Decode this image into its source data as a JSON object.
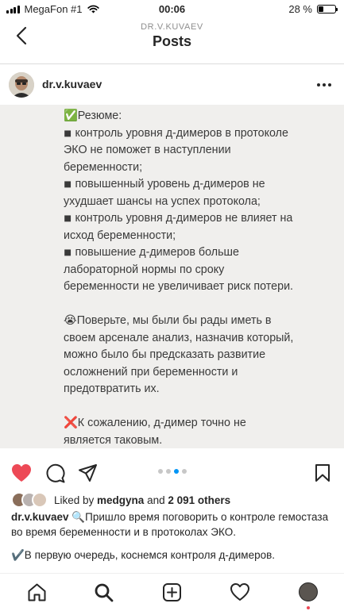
{
  "status_bar": {
    "carrier": "MegaFon #1",
    "time": "00:06",
    "battery": "28 %",
    "battery_level": 0.28
  },
  "header": {
    "subtitle": "DR.V.KUVAEV",
    "title": "Posts"
  },
  "post": {
    "author": "dr.v.kuvaev",
    "image_text": [
      "✅Резюме:",
      "◾ контроль уровня д-димеров в протоколе ЭКО не поможет в наступлении беременности;",
      "◾ повышенный уровень д-димеров не ухудшает шансы на успех протокола;",
      "◾ контроль уровня д-димеров не влияет на исход беременности;",
      "◾ повышение д-димеров больше лабораторной нормы по сроку беременности не увеличивает риск потери.",
      "",
      "😭Поверьте, мы были бы рады иметь в своем арсенале анализ, назначив который, можно было бы предсказать развитие осложнений при беременности и предотвратить их.",
      "",
      "❌К сожалению, д-димер точно не является таковым."
    ],
    "carousel": {
      "count": 4,
      "active_index": 2
    },
    "likes": {
      "prefix": "Liked by ",
      "user": "medgyna",
      "connector": " and ",
      "count": "2 091 others"
    },
    "caption": {
      "username": "dr.v.kuvaev",
      "text": " 🔍Пришло время поговорить о контроле гемостаза во время беременности и в протоколах ЭКО.",
      "second_line": "✔️В первую очередь, коснемся контроля д-димеров."
    }
  },
  "colors": {
    "like_red": "#ed4956",
    "carousel_active": "#0095f6",
    "text": "#262626",
    "muted": "#8e8e8e"
  },
  "icons": {
    "back": "chevron-left-icon",
    "more": "more-horizontal-icon",
    "like": "heart-filled-icon",
    "comment": "comment-icon",
    "share": "paper-plane-icon",
    "save": "bookmark-icon",
    "nav": [
      "home-icon",
      "search-icon",
      "add-post-icon",
      "activity-heart-icon",
      "profile-avatar"
    ]
  }
}
